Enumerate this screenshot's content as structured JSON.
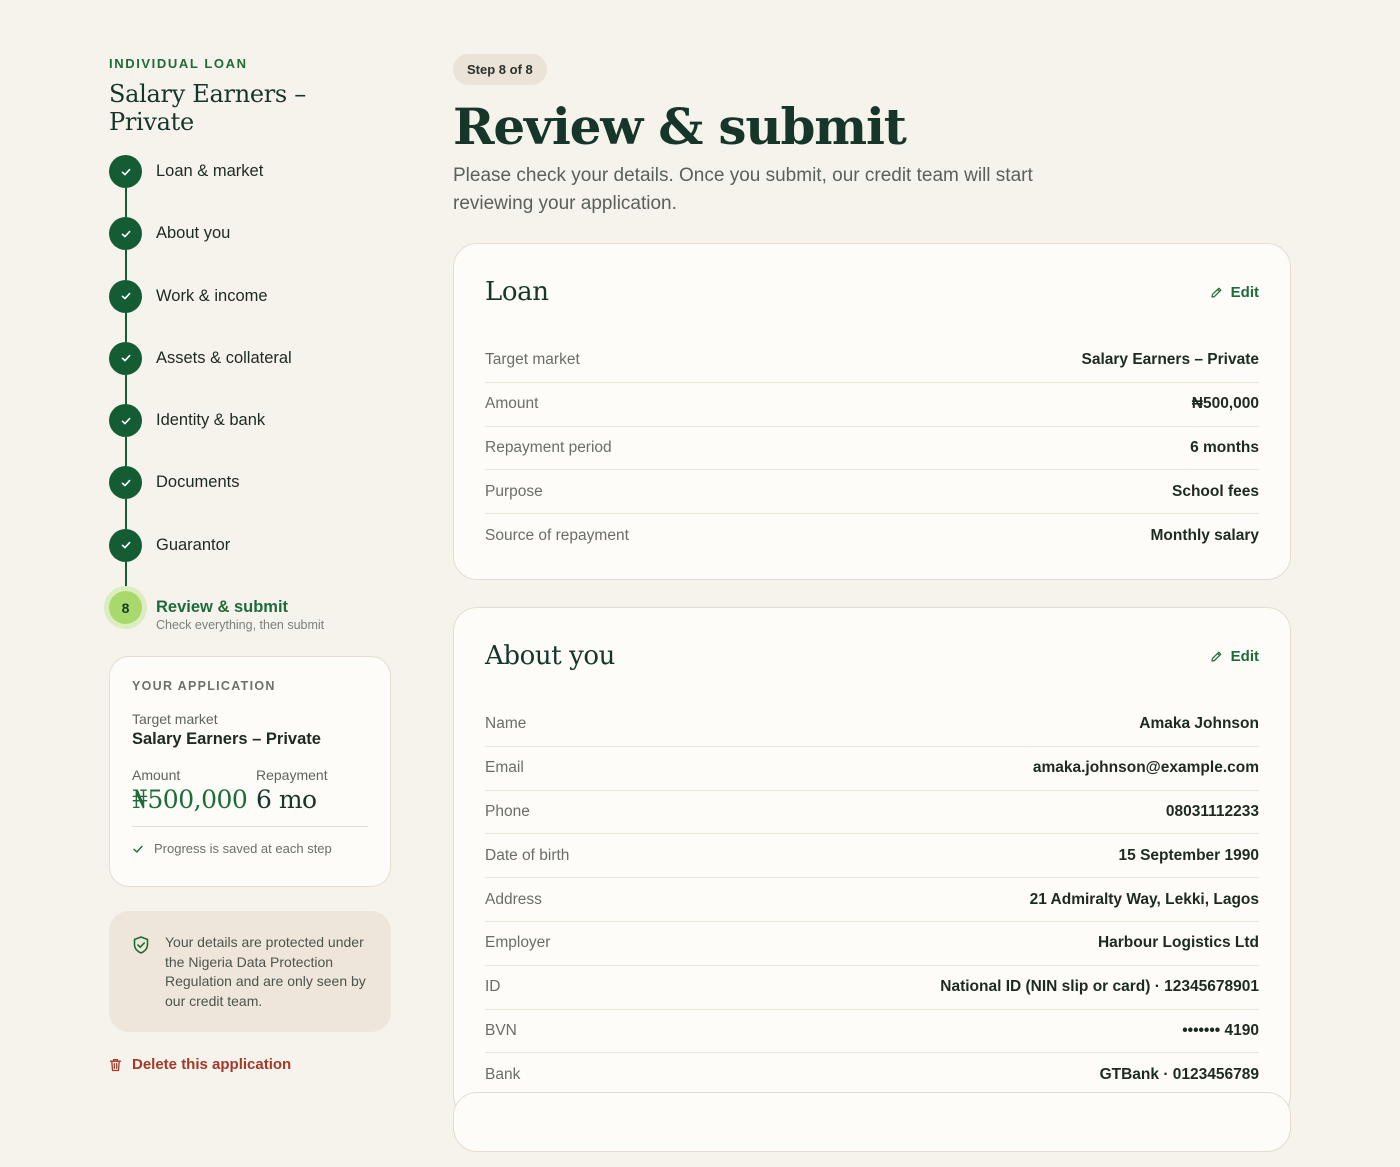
{
  "sidebar": {
    "eyebrow": "INDIVIDUAL LOAN",
    "title": "Salary Earners – Private",
    "steps": [
      {
        "label": "Loan & market",
        "state": "done"
      },
      {
        "label": "About you",
        "state": "done"
      },
      {
        "label": "Work & income",
        "state": "done"
      },
      {
        "label": "Assets & collateral",
        "state": "done"
      },
      {
        "label": "Identity & bank",
        "state": "done"
      },
      {
        "label": "Documents",
        "state": "done"
      },
      {
        "label": "Guarantor",
        "state": "done"
      },
      {
        "label": "Review & submit",
        "state": "current",
        "number": "8",
        "sub": "Check everything, then submit"
      }
    ],
    "application": {
      "caption": "YOUR APPLICATION",
      "target_market_label": "Target market",
      "target_market_value": "Salary Earners – Private",
      "amount_label": "Amount",
      "amount_value": "₦500,000",
      "repayment_label": "Repayment",
      "repayment_value": "6 mo",
      "saved_note": "Progress is saved at each step"
    },
    "protection_note": "Your details are protected under the Nigeria Data Protection Regulation and are only seen by our credit team.",
    "delete_label": "Delete this application"
  },
  "main": {
    "step_pill": "Step 8 of 8",
    "title": "Review & submit",
    "lede": "Please check your details. Once you submit, our credit team will start reviewing your application.",
    "edit_label": "Edit",
    "loan": {
      "title": "Loan",
      "rows": [
        {
          "k": "Target market",
          "v": "Salary Earners – Private"
        },
        {
          "k": "Amount",
          "v": "₦500,000"
        },
        {
          "k": "Repayment period",
          "v": "6 months"
        },
        {
          "k": "Purpose",
          "v": "School fees"
        },
        {
          "k": "Source of repayment",
          "v": "Monthly salary"
        }
      ]
    },
    "about": {
      "title": "About you",
      "rows": [
        {
          "k": "Name",
          "v": "Amaka Johnson"
        },
        {
          "k": "Email",
          "v": "amaka.johnson@example.com"
        },
        {
          "k": "Phone",
          "v": "08031112233"
        },
        {
          "k": "Date of birth",
          "v": "15 September 1990"
        },
        {
          "k": "Address",
          "v": "21 Admiralty Way, Lekki, Lagos"
        },
        {
          "k": "Employer",
          "v": "Harbour Logistics Ltd"
        },
        {
          "k": "ID",
          "v": "National ID (NIN slip or card) · 12345678901"
        },
        {
          "k": "BVN",
          "v": "••••••• 4190"
        },
        {
          "k": "Bank",
          "v": "GTBank · 0123456789"
        }
      ]
    }
  },
  "colors": {
    "accent_green": "#1e6b3a",
    "step_done": "#145c33",
    "step_current": "#a9d86c",
    "danger": "#a23a28",
    "background": "#f6f2ec"
  }
}
